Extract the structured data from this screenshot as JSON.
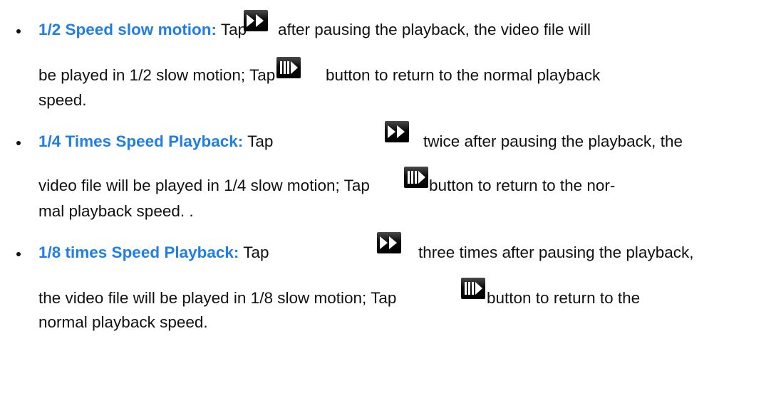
{
  "items": [
    {
      "term": "1/2 Speed slow motion:",
      "l1_a": "Tap",
      "l1_b": "after pausing the playback, the video file will",
      "l2_a": "be played in 1/2 slow motion; Tap",
      "l2_b": "button to return to the normal playback",
      "l3": "speed."
    },
    {
      "term": "1/4 Times Speed Playback:",
      "l1_a": "Tap",
      "l1_b": "twice after pausing the playback, the",
      "l2_a": "video file will be played in 1/4 slow motion; Tap",
      "l2_b": "button to return to the nor-",
      "l3": "mal playback speed. ."
    },
    {
      "term": "1/8 times Speed Playback:",
      "l1_a": "Tap",
      "l1_b": "three times after pausing the playback,",
      "l2_a": "the video file will be played in 1/8 slow motion; Tap",
      "l2_b": "button to return to the",
      "l3": "normal playback speed."
    }
  ],
  "icons": {
    "forward": "fast-forward-icon",
    "play_normal": "step-play-icon"
  }
}
